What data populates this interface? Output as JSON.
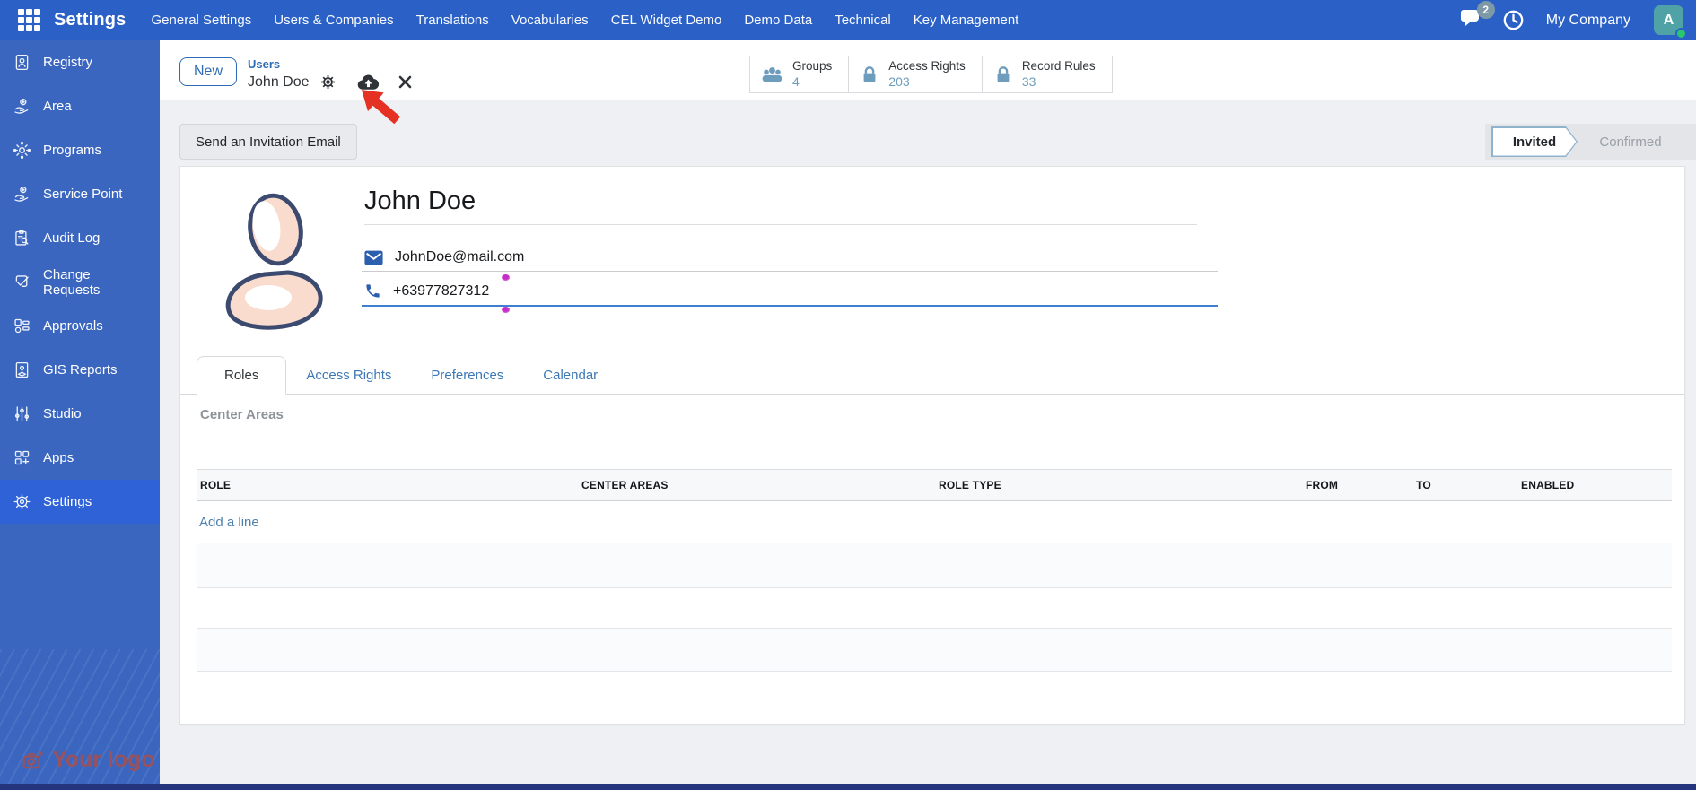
{
  "colors": {
    "topbar_bg": "#2b61c7",
    "sidebar_bg": "#3b66c0",
    "sidebar_active_bg": "#2e62d6",
    "accent_blue": "#2d6cb5",
    "stat_icon_blue": "#6d9cbc",
    "tab_link_blue": "#3d78b5",
    "focused_underline_blue": "#3f7fd0",
    "annotation_red": "#e53123",
    "annotation_magenta": "#c62cc9",
    "avatar_bg_teal": "#4fa3a6",
    "online_green": "#28c76f",
    "logo_maroon": "#96525e"
  },
  "topbar": {
    "apps_icon": "grid-icon",
    "title": "Settings",
    "menu": [
      "General Settings",
      "Users & Companies",
      "Translations",
      "Vocabularies",
      "CEL Widget Demo",
      "Demo Data",
      "Technical",
      "Key Management"
    ],
    "messages": {
      "icon": "chat-bubbles-icon",
      "badge": "2"
    },
    "activity_icon": "clock-icon",
    "company": "My Company",
    "user_avatar": {
      "initial": "A",
      "status": "online"
    }
  },
  "sidebar": {
    "items": [
      {
        "label": "Registry",
        "icon": "id-card-icon",
        "active": false
      },
      {
        "label": "Area",
        "icon": "hand-pin-icon",
        "active": false
      },
      {
        "label": "Programs",
        "icon": "gear-flower-icon",
        "active": false
      },
      {
        "label": "Service Point",
        "icon": "hand-pin-icon",
        "active": false
      },
      {
        "label": "Audit Log",
        "icon": "clipboard-search-icon",
        "active": false
      },
      {
        "label": "Change Requests",
        "icon": "check-box-icon",
        "active": false
      },
      {
        "label": "Approvals",
        "icon": "layout-blocks-icon",
        "active": false
      },
      {
        "label": "GIS Reports",
        "icon": "map-document-icon",
        "active": false
      },
      {
        "label": "Studio",
        "icon": "sliders-icon",
        "active": false
      },
      {
        "label": "Apps",
        "icon": "app-grid-plus-icon",
        "active": false
      },
      {
        "label": "Settings",
        "icon": "gear-icon",
        "active": true
      }
    ],
    "logo_text": "Your logo",
    "logo_icon": "camera-plus-icon"
  },
  "control_panel": {
    "new_button": "New",
    "breadcrumb_parent": "Users",
    "breadcrumb_current": "John Doe",
    "record_icons": [
      "gear-icon",
      "cloud-upload-icon",
      "close-icon"
    ],
    "stat_buttons": [
      {
        "icon": "users-icon",
        "label": "Groups",
        "value": "4"
      },
      {
        "icon": "lock-icon",
        "label": "Access Rights",
        "value": "203"
      },
      {
        "icon": "lock-icon",
        "label": "Record Rules",
        "value": "33"
      }
    ]
  },
  "actions": {
    "send_invitation": "Send an Invitation Email"
  },
  "statusbar": {
    "states": [
      "Invited",
      "Confirmed"
    ],
    "active_state": "Invited"
  },
  "form": {
    "name": "John Doe",
    "email": {
      "icon": "envelope-icon",
      "value": "JohnDoe@mail.com"
    },
    "phone": {
      "icon": "phone-icon",
      "value": "+63977827312"
    },
    "avatar_placeholder": "person-silhouette"
  },
  "tabs": [
    {
      "label": "Roles",
      "active": true
    },
    {
      "label": "Access Rights",
      "active": false
    },
    {
      "label": "Preferences",
      "active": false
    },
    {
      "label": "Calendar",
      "active": false
    }
  ],
  "roles_section": {
    "title": "Center Areas",
    "table": {
      "headers": [
        "ROLE",
        "CENTER AREAS",
        "ROLE TYPE",
        "FROM",
        "TO",
        "ENABLED"
      ],
      "rows": [],
      "add_line_label": "Add a line"
    }
  },
  "annotations": {
    "red_arrow_points_at": "cloud-upload-icon",
    "magenta_dot_count": 2
  }
}
